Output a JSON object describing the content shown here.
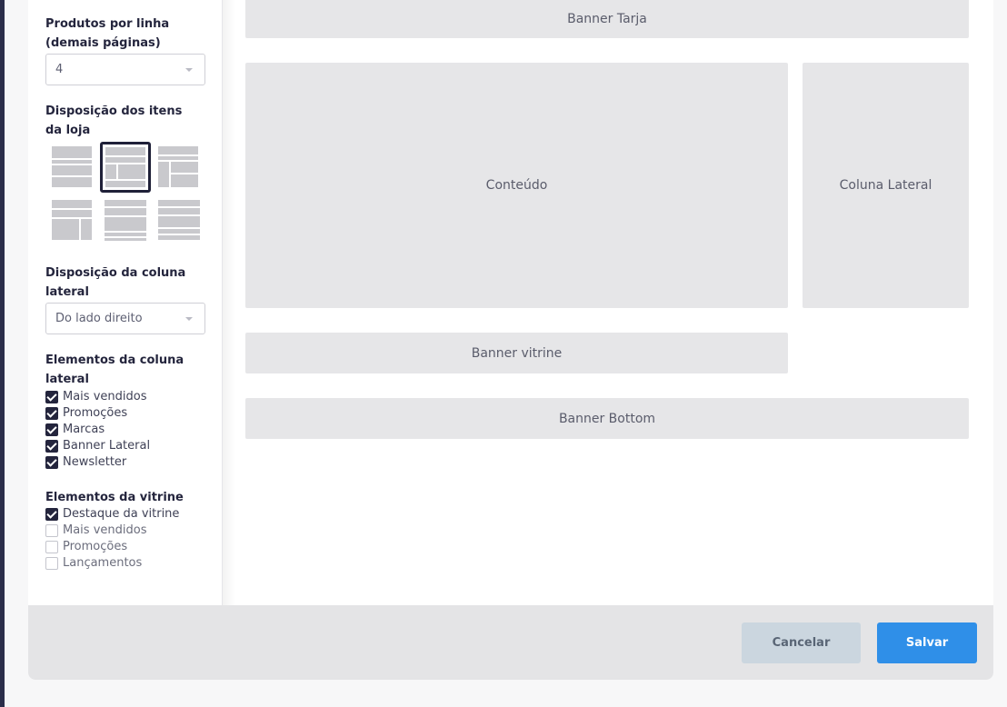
{
  "sidebar": {
    "products_per_line": {
      "label": "Produtos por linha (demais páginas)",
      "value": "4"
    },
    "store_layout": {
      "label": "Disposição dos itens da loja",
      "selected_index": 1
    },
    "sidebar_column": {
      "label": "Disposição da coluna lateral",
      "value": "Do lado direito"
    },
    "sidebar_elements": {
      "label": "Elementos da coluna lateral",
      "items": [
        {
          "label": "Mais vendidos",
          "checked": true
        },
        {
          "label": "Promoções",
          "checked": true
        },
        {
          "label": "Marcas",
          "checked": true
        },
        {
          "label": "Banner Lateral",
          "checked": true
        },
        {
          "label": "Newsletter",
          "checked": true
        }
      ]
    },
    "showcase_elements": {
      "label": "Elementos da vitrine",
      "items": [
        {
          "label": "Destaque da vitrine",
          "checked": true
        },
        {
          "label": "Mais vendidos",
          "checked": false
        },
        {
          "label": "Promoções",
          "checked": false
        },
        {
          "label": "Lançamentos",
          "checked": false
        }
      ]
    }
  },
  "preview": {
    "banner_tarja": "Banner Tarja",
    "conteudo": "Conteúdo",
    "coluna_lateral": "Coluna Lateral",
    "banner_vitrine": "Banner vitrine",
    "banner_bottom": "Banner Bottom"
  },
  "footer": {
    "cancel_label": "Cancelar",
    "save_label": "Salvar"
  },
  "colors": {
    "accent": "#2f8fe8",
    "dark": "#24253d",
    "zone": "#e6e6e8"
  }
}
